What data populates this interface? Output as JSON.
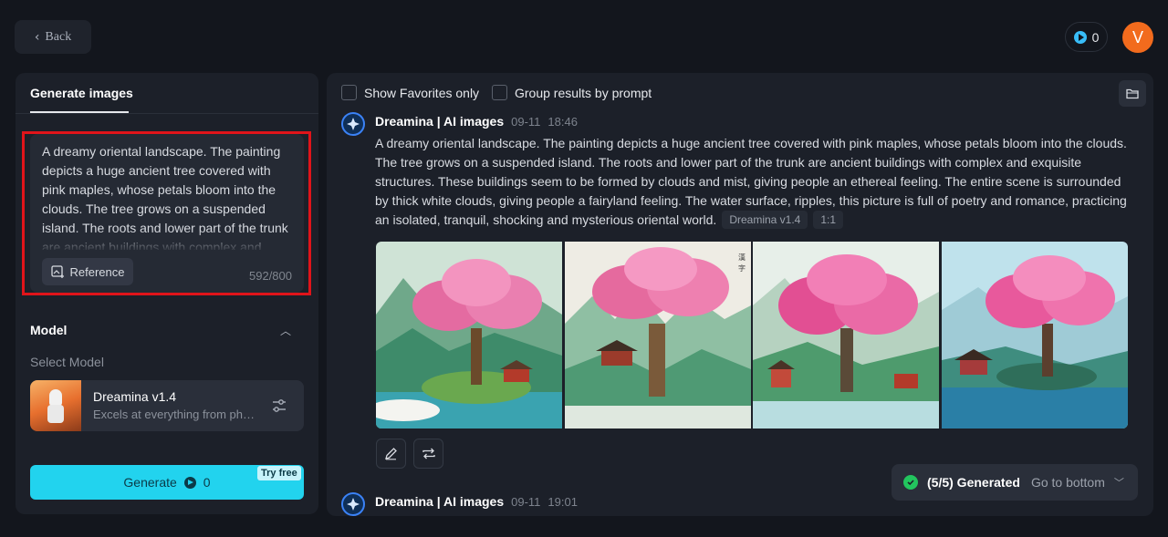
{
  "header": {
    "back_label": "Back",
    "credits": "0",
    "avatar_letter": "V"
  },
  "left_panel": {
    "tab_label": "Generate images",
    "prompt_text": "A dreamy oriental landscape. The painting depicts a huge ancient tree covered with pink maples, whose petals bloom into the clouds. The tree grows on a suspended island. The roots and lower part of the trunk are ancient buildings with complex and exquisite structures.",
    "reference_label": "Reference",
    "char_counter": "592/800",
    "model_section_title": "Model",
    "select_model_label": "Select Model",
    "model_name": "Dreamina v1.4",
    "model_desc": "Excels at everything from photorealism to painterly styles",
    "generate_label": "Generate",
    "generate_cost": "0",
    "try_free_label": "Try free"
  },
  "toolbar": {
    "show_favorites_label": "Show Favorites only",
    "group_results_label": "Group results by prompt"
  },
  "entries": [
    {
      "source": "Dreamina | AI images",
      "date": "09-11",
      "time": "18:46",
      "prompt": "A dreamy oriental landscape. The painting depicts a huge ancient tree covered with pink maples, whose petals bloom into the clouds. The tree grows on a suspended island. The roots and lower part of the trunk are ancient buildings with complex and exquisite structures. These buildings seem to be formed by clouds and mist, giving people an ethereal feeling. The entire scene is surrounded by thick white clouds, giving people a fairyland feeling. The water surface, ripples, this picture is full of poetry and romance, practicing an isolated, tranquil, shocking and mysterious oriental world.",
      "model_tag": "Dreamina v1.4",
      "ratio_tag": "1:1"
    },
    {
      "source": "Dreamina | AI images",
      "date": "09-11",
      "time": "19:01"
    }
  ],
  "status": {
    "generated_text": "(5/5) Generated",
    "go_bottom_label": "Go to bottom"
  },
  "colors": {
    "accent": "#22d3ee",
    "avatar": "#f26b1d",
    "highlight_border": "#e0141a",
    "success": "#22c55e"
  }
}
